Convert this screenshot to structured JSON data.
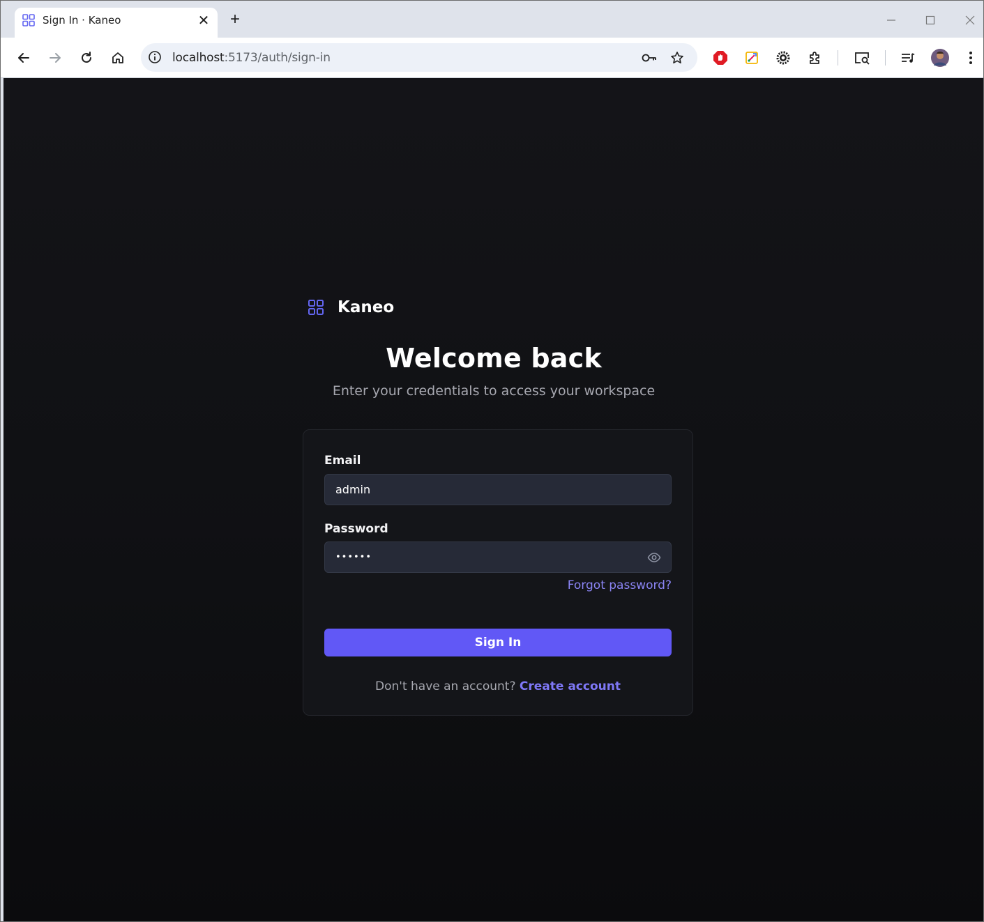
{
  "browser": {
    "tab_title": "Sign In · Kaneo",
    "tab_close_glyph": "✕",
    "new_tab_glyph": "+",
    "url_host": "localhost",
    "url_rest": ":5173/auth/sign-in",
    "window_controls": {
      "minimize": "—",
      "maximize": "☐",
      "close": "✕"
    }
  },
  "brand": {
    "name": "Kaneo",
    "icon": "grid-icon",
    "accent": "#6366f1"
  },
  "header": {
    "title": "Welcome back",
    "subtitle": "Enter your credentials to access your workspace"
  },
  "form": {
    "email_label": "Email",
    "email_value": "admin",
    "password_label": "Password",
    "password_value": "••••••",
    "forgot_link": "Forgot password?",
    "submit_label": "Sign In",
    "no_account_text": "Don't have an account?",
    "create_account_link": "Create account"
  },
  "colors": {
    "page_background": "#121215",
    "card_background": "#141519",
    "input_background": "#262a37",
    "primary_button": "#6158f6",
    "link": "#8b85f5"
  }
}
